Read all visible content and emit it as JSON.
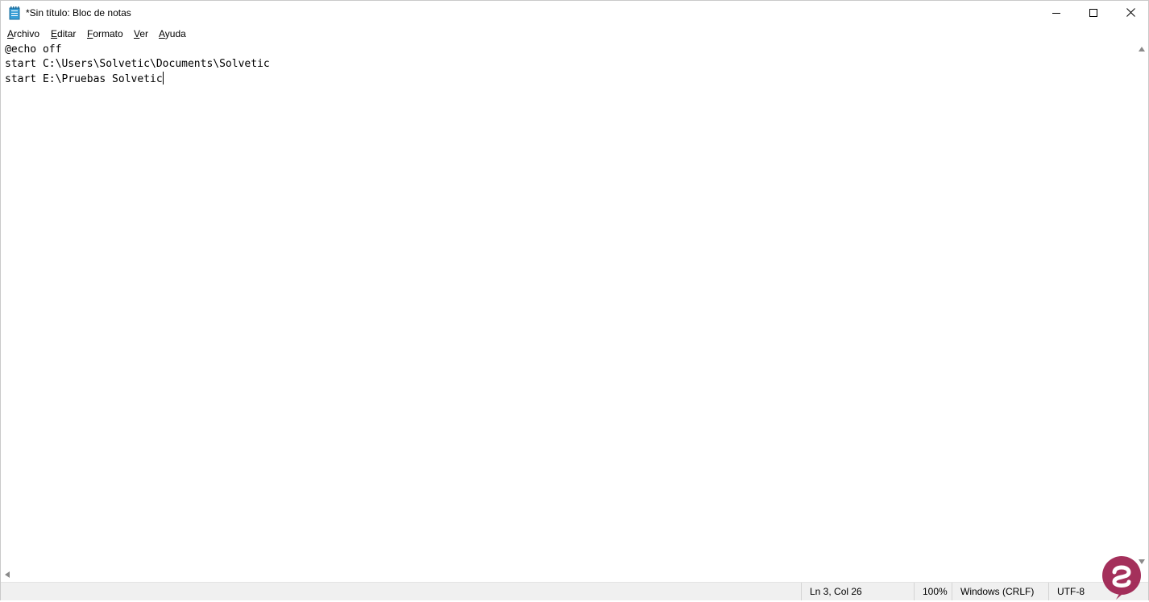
{
  "window": {
    "title": "*Sin título: Bloc de notas",
    "app_icon": "notepad-icon",
    "caption_buttons": [
      "minimize-icon",
      "maximize-icon",
      "close-icon"
    ]
  },
  "menu": {
    "items": [
      {
        "label": "Archivo",
        "accel": "A",
        "rest": "rchivo"
      },
      {
        "label": "Editar",
        "accel": "E",
        "rest": "ditar"
      },
      {
        "label": "Formato",
        "accel": "F",
        "rest": "ormato"
      },
      {
        "label": "Ver",
        "accel": "V",
        "rest": "er"
      },
      {
        "label": "Ayuda",
        "accel": "A",
        "rest": "yuda"
      }
    ]
  },
  "editor": {
    "lines": [
      "@echo off",
      "start C:\\Users\\Solvetic\\Documents\\Solvetic",
      "start E:\\Pruebas Solvetic"
    ]
  },
  "status": {
    "position": "Ln 3, Col 26",
    "zoom": "100%",
    "line_ending": "Windows (CRLF)",
    "encoding": "UTF-8"
  },
  "colors": {
    "watermark": "#9b1a4a"
  }
}
